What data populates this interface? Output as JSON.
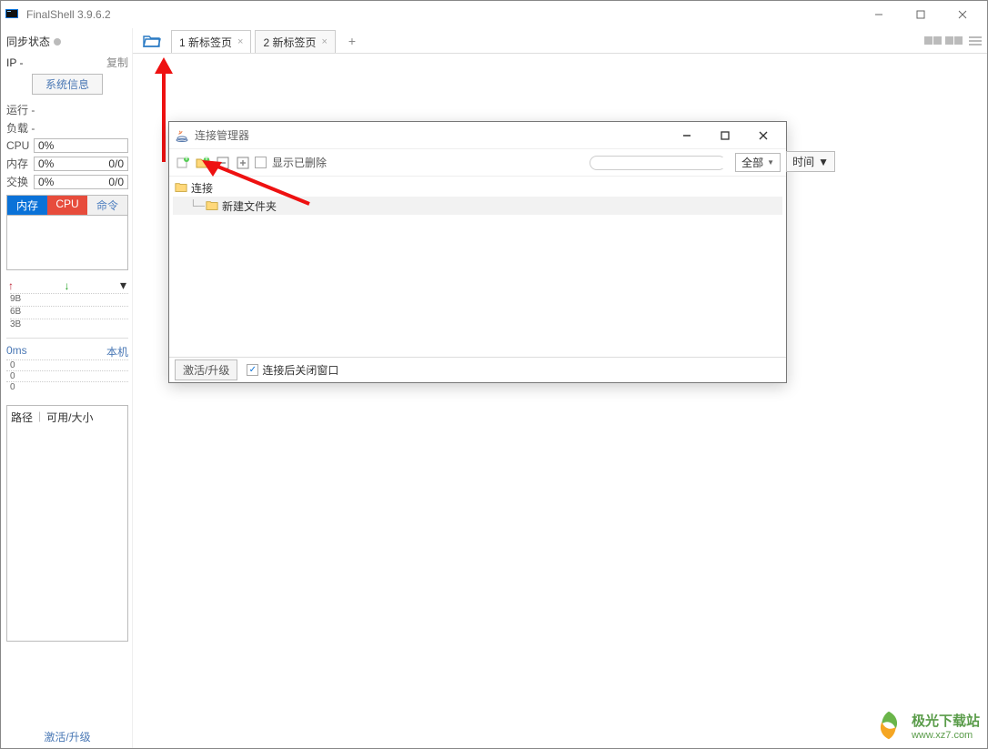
{
  "titlebar": {
    "app_name": "FinalShell 3.9.6.2"
  },
  "sidebar": {
    "sync_label": "同步状态",
    "ip_label": "IP  -",
    "copy_label": "复制",
    "sysinfo_btn": "系统信息",
    "run_label": "运行 -",
    "load_label": "负载 -",
    "rows": [
      {
        "label": "CPU",
        "left": "0%",
        "right": ""
      },
      {
        "label": "内存",
        "left": "0%",
        "right": "0/0"
      },
      {
        "label": "交换",
        "left": "0%",
        "right": "0/0"
      }
    ],
    "tabs": {
      "mem": "内存",
      "cpu": "CPU",
      "cmd": "命令"
    },
    "net_ticks": [
      "9B",
      "6B",
      "3B"
    ],
    "ping_label": "0ms",
    "local_label": "本机",
    "ping_ticks": [
      "0",
      "0",
      "0"
    ],
    "path_head": {
      "path": "路径",
      "size": "可用/大小"
    },
    "activate": "激活/升级"
  },
  "tabstrip": {
    "tabs": [
      {
        "label": "1 新标签页",
        "active": true
      },
      {
        "label": "2 新标签页",
        "active": false
      }
    ]
  },
  "dialog": {
    "title": "连接管理器",
    "show_deleted": "显示已删除",
    "filter_all": "全部",
    "extra_btn": "时间",
    "tree_root": "连接",
    "tree_child": "新建文件夹",
    "foot_activate": "激活/升级",
    "close_after": "连接后关闭窗口"
  },
  "watermark": {
    "line1": "极光下载站",
    "line2": "www.xz7.com"
  }
}
